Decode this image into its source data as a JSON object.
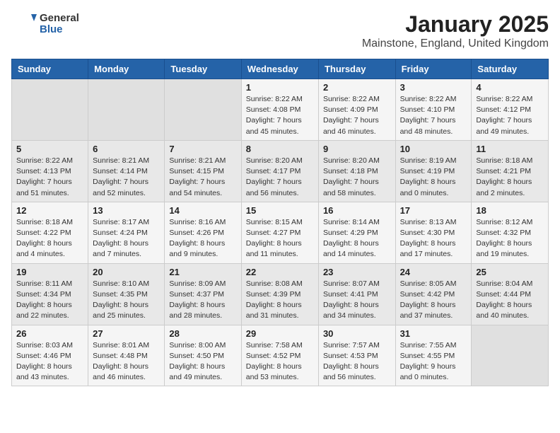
{
  "header": {
    "logo_general": "General",
    "logo_blue": "Blue",
    "title": "January 2025",
    "subtitle": "Mainstone, England, United Kingdom"
  },
  "days_of_week": [
    "Sunday",
    "Monday",
    "Tuesday",
    "Wednesday",
    "Thursday",
    "Friday",
    "Saturday"
  ],
  "weeks": [
    [
      {
        "day": "",
        "info": ""
      },
      {
        "day": "",
        "info": ""
      },
      {
        "day": "",
        "info": ""
      },
      {
        "day": "1",
        "info": "Sunrise: 8:22 AM\nSunset: 4:08 PM\nDaylight: 7 hours and 45 minutes."
      },
      {
        "day": "2",
        "info": "Sunrise: 8:22 AM\nSunset: 4:09 PM\nDaylight: 7 hours and 46 minutes."
      },
      {
        "day": "3",
        "info": "Sunrise: 8:22 AM\nSunset: 4:10 PM\nDaylight: 7 hours and 48 minutes."
      },
      {
        "day": "4",
        "info": "Sunrise: 8:22 AM\nSunset: 4:12 PM\nDaylight: 7 hours and 49 minutes."
      }
    ],
    [
      {
        "day": "5",
        "info": "Sunrise: 8:22 AM\nSunset: 4:13 PM\nDaylight: 7 hours and 51 minutes."
      },
      {
        "day": "6",
        "info": "Sunrise: 8:21 AM\nSunset: 4:14 PM\nDaylight: 7 hours and 52 minutes."
      },
      {
        "day": "7",
        "info": "Sunrise: 8:21 AM\nSunset: 4:15 PM\nDaylight: 7 hours and 54 minutes."
      },
      {
        "day": "8",
        "info": "Sunrise: 8:20 AM\nSunset: 4:17 PM\nDaylight: 7 hours and 56 minutes."
      },
      {
        "day": "9",
        "info": "Sunrise: 8:20 AM\nSunset: 4:18 PM\nDaylight: 7 hours and 58 minutes."
      },
      {
        "day": "10",
        "info": "Sunrise: 8:19 AM\nSunset: 4:19 PM\nDaylight: 8 hours and 0 minutes."
      },
      {
        "day": "11",
        "info": "Sunrise: 8:18 AM\nSunset: 4:21 PM\nDaylight: 8 hours and 2 minutes."
      }
    ],
    [
      {
        "day": "12",
        "info": "Sunrise: 8:18 AM\nSunset: 4:22 PM\nDaylight: 8 hours and 4 minutes."
      },
      {
        "day": "13",
        "info": "Sunrise: 8:17 AM\nSunset: 4:24 PM\nDaylight: 8 hours and 7 minutes."
      },
      {
        "day": "14",
        "info": "Sunrise: 8:16 AM\nSunset: 4:26 PM\nDaylight: 8 hours and 9 minutes."
      },
      {
        "day": "15",
        "info": "Sunrise: 8:15 AM\nSunset: 4:27 PM\nDaylight: 8 hours and 11 minutes."
      },
      {
        "day": "16",
        "info": "Sunrise: 8:14 AM\nSunset: 4:29 PM\nDaylight: 8 hours and 14 minutes."
      },
      {
        "day": "17",
        "info": "Sunrise: 8:13 AM\nSunset: 4:30 PM\nDaylight: 8 hours and 17 minutes."
      },
      {
        "day": "18",
        "info": "Sunrise: 8:12 AM\nSunset: 4:32 PM\nDaylight: 8 hours and 19 minutes."
      }
    ],
    [
      {
        "day": "19",
        "info": "Sunrise: 8:11 AM\nSunset: 4:34 PM\nDaylight: 8 hours and 22 minutes."
      },
      {
        "day": "20",
        "info": "Sunrise: 8:10 AM\nSunset: 4:35 PM\nDaylight: 8 hours and 25 minutes."
      },
      {
        "day": "21",
        "info": "Sunrise: 8:09 AM\nSunset: 4:37 PM\nDaylight: 8 hours and 28 minutes."
      },
      {
        "day": "22",
        "info": "Sunrise: 8:08 AM\nSunset: 4:39 PM\nDaylight: 8 hours and 31 minutes."
      },
      {
        "day": "23",
        "info": "Sunrise: 8:07 AM\nSunset: 4:41 PM\nDaylight: 8 hours and 34 minutes."
      },
      {
        "day": "24",
        "info": "Sunrise: 8:05 AM\nSunset: 4:42 PM\nDaylight: 8 hours and 37 minutes."
      },
      {
        "day": "25",
        "info": "Sunrise: 8:04 AM\nSunset: 4:44 PM\nDaylight: 8 hours and 40 minutes."
      }
    ],
    [
      {
        "day": "26",
        "info": "Sunrise: 8:03 AM\nSunset: 4:46 PM\nDaylight: 8 hours and 43 minutes."
      },
      {
        "day": "27",
        "info": "Sunrise: 8:01 AM\nSunset: 4:48 PM\nDaylight: 8 hours and 46 minutes."
      },
      {
        "day": "28",
        "info": "Sunrise: 8:00 AM\nSunset: 4:50 PM\nDaylight: 8 hours and 49 minutes."
      },
      {
        "day": "29",
        "info": "Sunrise: 7:58 AM\nSunset: 4:52 PM\nDaylight: 8 hours and 53 minutes."
      },
      {
        "day": "30",
        "info": "Sunrise: 7:57 AM\nSunset: 4:53 PM\nDaylight: 8 hours and 56 minutes."
      },
      {
        "day": "31",
        "info": "Sunrise: 7:55 AM\nSunset: 4:55 PM\nDaylight: 9 hours and 0 minutes."
      },
      {
        "day": "",
        "info": ""
      }
    ]
  ]
}
